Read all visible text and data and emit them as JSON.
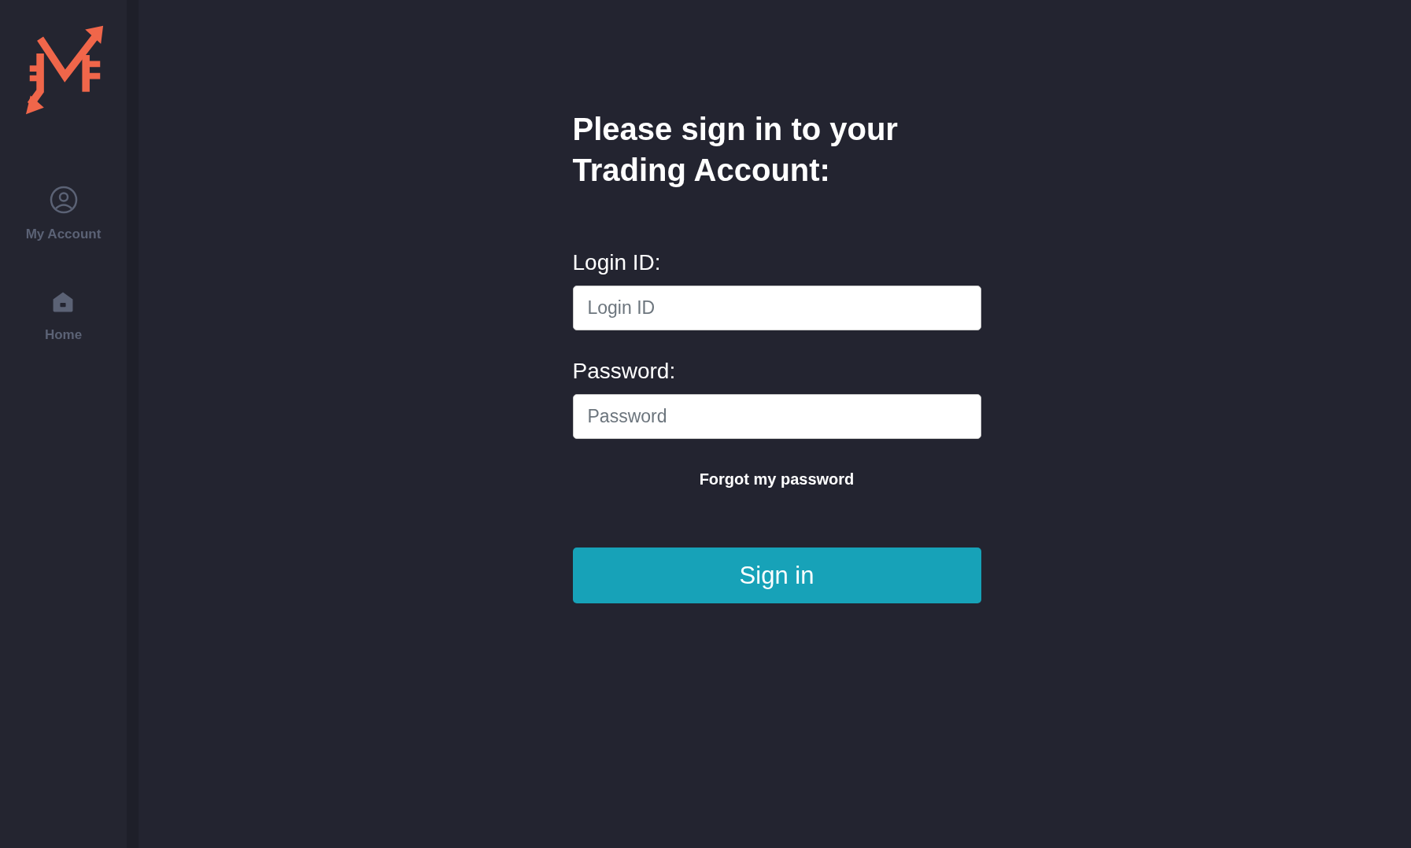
{
  "sidebar": {
    "items": [
      {
        "kind": "account",
        "label": "My Account"
      },
      {
        "kind": "home",
        "label": "Home"
      }
    ]
  },
  "form": {
    "title": "Please sign in to your Trading Account:",
    "fields": [
      {
        "label": "Login ID:",
        "placeholder": "Login ID"
      },
      {
        "label": "Password:",
        "placeholder": "Password"
      }
    ],
    "forgot_link": "Forgot my password",
    "submit": "Sign in"
  }
}
